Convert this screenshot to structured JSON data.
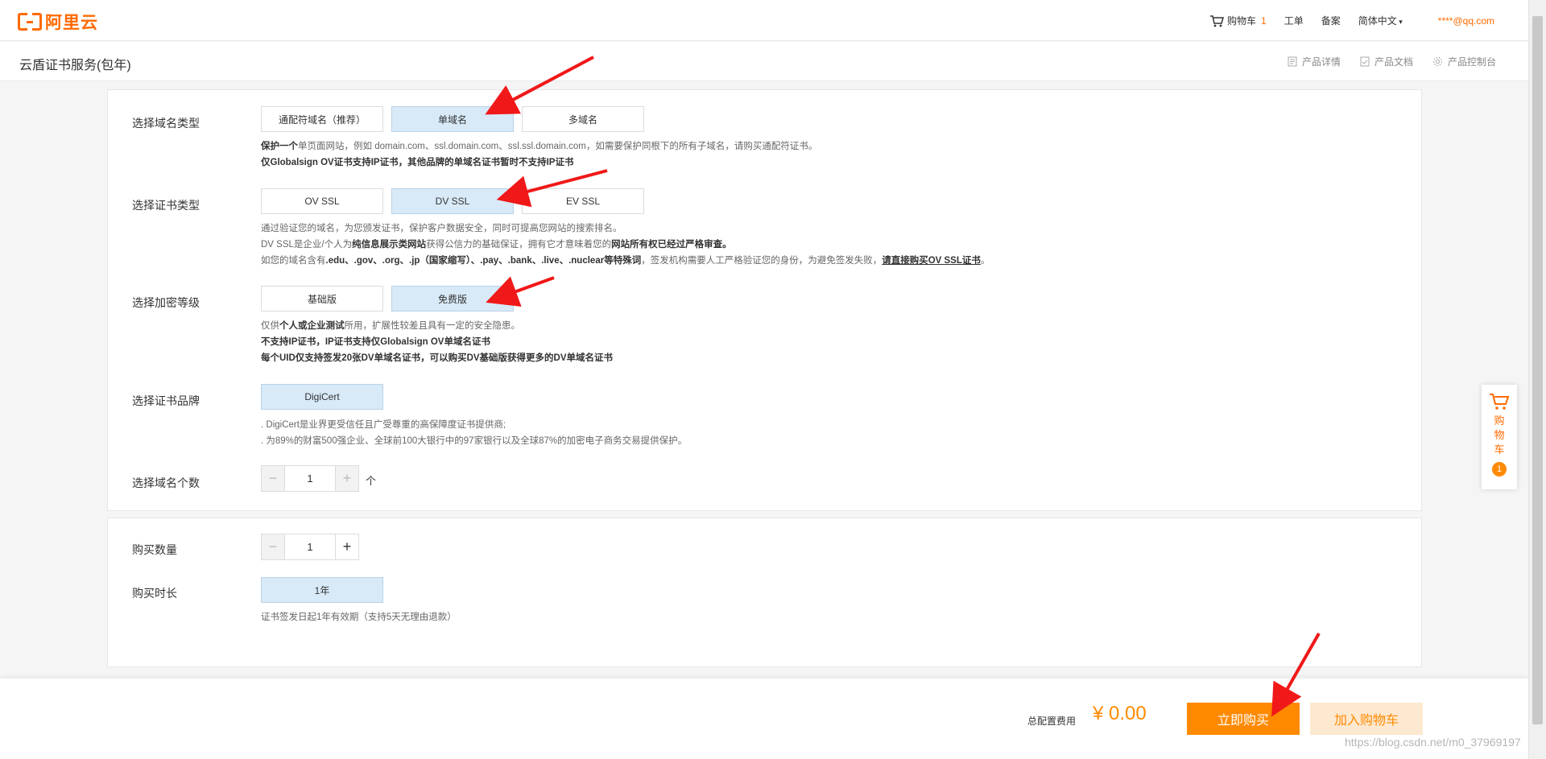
{
  "topbar": {
    "logo_text": "阿里云",
    "cart_label": "购物车",
    "cart_count": "1",
    "workorder": "工单",
    "beian": "备案",
    "language": "简体中文",
    "user": "****@qq.com"
  },
  "product": {
    "title": "云盾证书服务(包年)",
    "links": [
      "产品详情",
      "产品文档",
      "产品控制台"
    ]
  },
  "domain_type": {
    "label": "选择域名类型",
    "options": [
      "通配符域名（推荐）",
      "单域名",
      "多域名"
    ],
    "selected": "单域名",
    "desc1_bold": "保护一个",
    "desc1": "单页面网站，例如 domain.com、ssl.domain.com、ssl.ssl.domain.com，如需要保护同根下的所有子域名，请购买通配符证书。",
    "desc2": "仅Globalsign OV证书支持IP证书，其他品牌的单域名证书暂时不支持IP证书"
  },
  "cert_type": {
    "label": "选择证书类型",
    "options": [
      "OV SSL",
      "DV SSL",
      "EV SSL"
    ],
    "selected": "DV SSL",
    "desc1": "通过验证您的域名，为您颁发证书，保护客户数据安全，同时可提高您网站的搜索排名。",
    "desc2_a": "DV SSL是企业/个人为",
    "desc2_b": "纯信息展示类网站",
    "desc2_c": "获得公信力的基础保证，拥有它才意味着您的",
    "desc2_d": "网站所有权已经过严格审查。",
    "desc3_a": "如您的域名含有",
    "desc3_b": ".edu、.gov、.org、.jp（国家缩写）、.pay、.bank、.live、.nuclear等特殊词",
    "desc3_c": "，签发机构需要人工严格验证您的身份，为避免签发失败，",
    "desc3_d": "请直接购买OV SSL证书",
    "desc3_e": "。"
  },
  "encryption": {
    "label": "选择加密等级",
    "options": [
      "基础版",
      "免费版"
    ],
    "selected": "免费版",
    "desc1_a": "仅供",
    "desc1_b": "个人或企业测试",
    "desc1_c": "所用，扩展性较差且具有一定的安全隐患。",
    "desc2": "不支持IP证书，IP证书支持仅Globalsign OV单域名证书",
    "desc3": "每个UID仅支持签发20张DV单域名证书，可以购买DV基础版获得更多的DV单域名证书"
  },
  "brand": {
    "label": "选择证书品牌",
    "options": [
      "DigiCert"
    ],
    "desc1": ". DigiCert是业界更受信任且广受尊重的高保障度证书提供商;",
    "desc2": ". 为89%的财富500强企业、全球前100大银行中的97家银行以及全球87%的加密电子商务交易提供保护。"
  },
  "domain_count": {
    "label": "选择域名个数",
    "value": "1",
    "unit": "个"
  },
  "quantity": {
    "label": "购买数量",
    "value": "1"
  },
  "duration": {
    "label": "购买时长",
    "option": "1年",
    "desc": "证书签发日起1年有效期（支持5天无理由退款）"
  },
  "float_cart": {
    "text": "购物车",
    "count": "1"
  },
  "footer": {
    "total_label": "总配置费用",
    "total_price": "¥ 0.00",
    "buy_label": "立即购买",
    "addcart_label": "加入购物车",
    "watermark": "https://blog.csdn.net/m0_37969197"
  },
  "colors": {
    "brand": "#ff6a00",
    "accent": "#ff8a00",
    "selected_bg": "#d8eaf8",
    "arrow": "#f01818"
  }
}
